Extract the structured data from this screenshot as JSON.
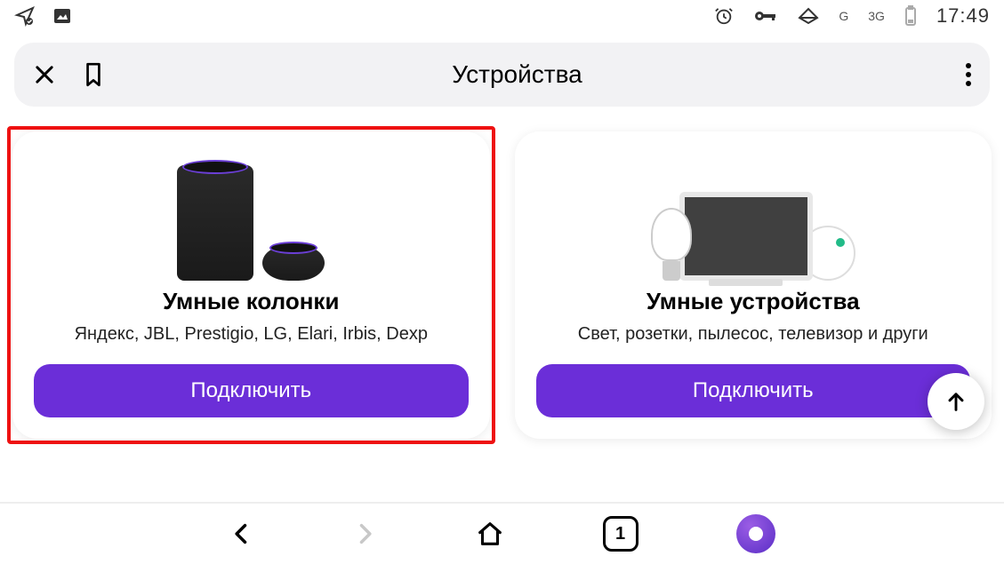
{
  "status": {
    "network_g": "G",
    "network_3g": "3G",
    "clock": "17:49"
  },
  "titlebar": {
    "title": "Устройства"
  },
  "cards": [
    {
      "title": "Умные колонки",
      "subtitle": "Яндекс, JBL, Prestigio, LG, Elari, Irbis, Dexp",
      "button": "Подключить",
      "highlighted": true
    },
    {
      "title": "Умные устройства",
      "subtitle": "Свет, розетки, пылесос, телевизор и други",
      "button": "Подключить",
      "highlighted": false
    }
  ],
  "bottom_nav": {
    "tab_count": "1"
  }
}
